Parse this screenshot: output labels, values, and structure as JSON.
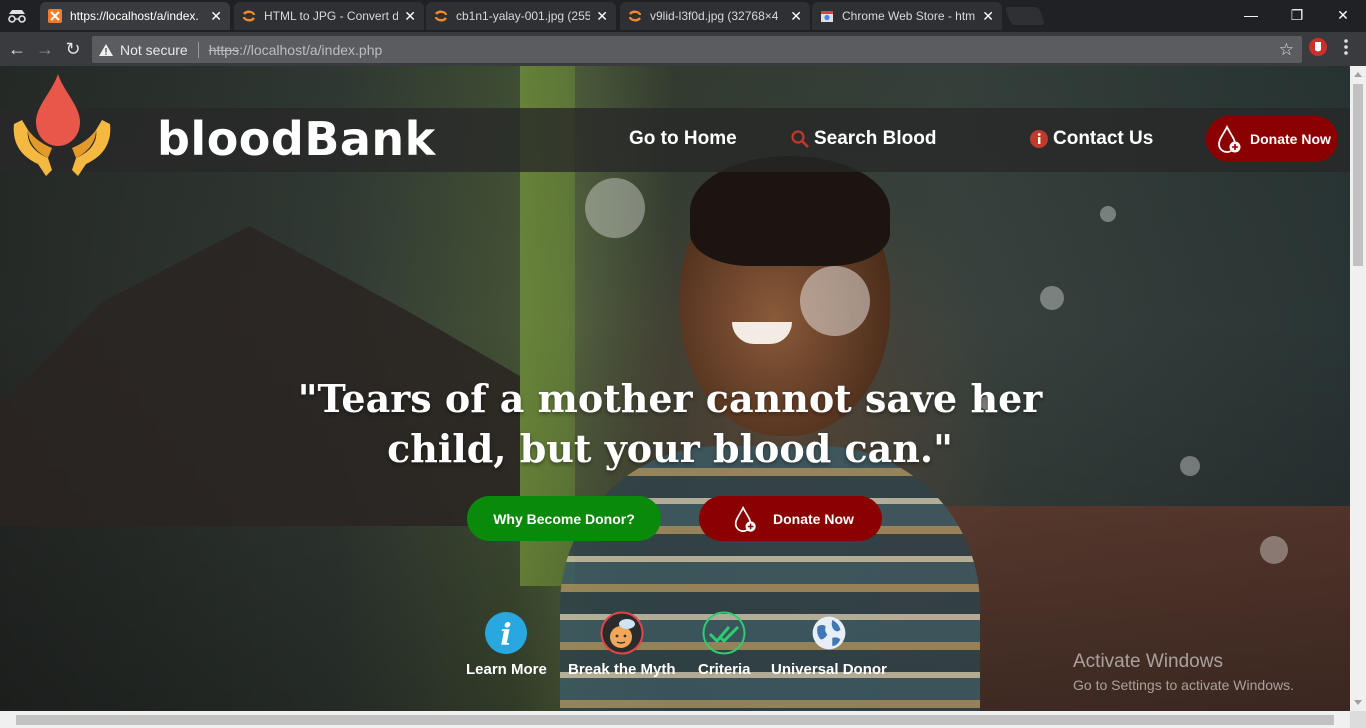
{
  "browser": {
    "tabs": [
      {
        "title": "https://localhost/a/index.",
        "favicon": "xampp-icon",
        "active": true
      },
      {
        "title": "HTML to JPG - Convert d",
        "favicon": "swirl-icon",
        "active": false
      },
      {
        "title": "cb1n1-yalay-001.jpg (255",
        "favicon": "swirl-icon",
        "active": false
      },
      {
        "title": "v9lid-l3f0d.jpg (32768×4",
        "favicon": "swirl-icon",
        "active": false
      },
      {
        "title": "Chrome Web Store - htm",
        "favicon": "webstore-icon",
        "active": false
      }
    ],
    "address": {
      "security_label": "Not secure",
      "scheme": "https",
      "rest": "://localhost/a/index.php"
    }
  },
  "site": {
    "brand": "bloodBank",
    "nav": {
      "home": "Go to Home",
      "search": "Search Blood",
      "contact": "Contact Us",
      "donate": "Donate Now"
    },
    "hero": {
      "quote_line1": "\"Tears of a mother cannot save her",
      "quote_line2": "child, but your blood can.\"",
      "why_button": "Why Become Donor?",
      "donate_button": "Donate Now"
    },
    "features": [
      {
        "label": "Learn More",
        "icon": "info-icon"
      },
      {
        "label": "Break the Myth",
        "icon": "myth-face-icon"
      },
      {
        "label": "Criteria",
        "icon": "double-check-icon"
      },
      {
        "label": "Universal Donor",
        "icon": "globe-icon"
      }
    ],
    "colors": {
      "donate_red": "#8b0000",
      "why_green": "#0a8a0a",
      "drop_red": "#e8574a",
      "hands_yellow": "#f5b942"
    }
  },
  "os_overlay": {
    "line1": "Activate Windows",
    "line2": "Go to Settings to activate Windows."
  }
}
